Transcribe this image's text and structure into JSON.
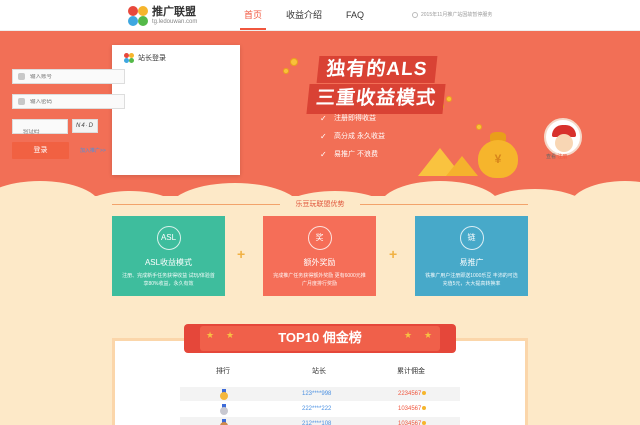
{
  "header": {
    "logo_title": "推广联盟",
    "logo_sub": "tg.ledouwan.com",
    "nav": [
      {
        "label": "首页",
        "active": true
      },
      {
        "label": "收益介绍",
        "active": false
      },
      {
        "label": "FAQ",
        "active": false
      }
    ],
    "notice": "2015年11月推广站因故暂停服务"
  },
  "login": {
    "title": "站长登录",
    "username_placeholder": "输入账号",
    "password_placeholder": "输入密码",
    "captcha_placeholder": "验证码",
    "captcha_text": "N4·D",
    "submit_label": "登录",
    "promo_link": "加入推广>>"
  },
  "hero": {
    "slogan_line1": "独有的ALS",
    "slogan_line2": "三重收益模式",
    "features": [
      "注册即得收益",
      "高分成  永久收益",
      "易推广  不浪费"
    ],
    "avatar_caption_prefix": "查看 ",
    "avatar_caption_link": "注册"
  },
  "advantages": {
    "section_title": "乐豆玩联盟优势",
    "cards": [
      {
        "icon_text": "ASL",
        "title": "ASL收益模式",
        "desc": "注册、完成新手任务获得收益 试玩/体验首享80%收益，永久有效",
        "color": "#3ebd9d"
      },
      {
        "icon_text": "奖",
        "title": "额外奖励",
        "desc": "完成推广任务获得额外奖励 更有6000元推广月度排行奖励",
        "color": "#f56e58"
      },
      {
        "icon_text": "链",
        "title": "易推广",
        "desc": "铁推广用户注册即送1000乐豆 丰沛的可选充值5元，大大提高转换率",
        "color": "#47a9c9"
      }
    ]
  },
  "ranking": {
    "title": "TOP10 佣金榜",
    "headers": [
      "排行",
      "站长",
      "累计佣金"
    ],
    "rows": [
      {
        "site": "123****998",
        "amount": "2234567",
        "medal": "#f5b73b"
      },
      {
        "site": "222****222",
        "amount": "1034567",
        "medal": "#c8c8d0"
      },
      {
        "site": "212****108",
        "amount": "1034567",
        "medal": "#d08a4d"
      }
    ]
  },
  "colors": {
    "accent": "#f0563e",
    "hero_bg": "#f26f56",
    "cream": "#fde9c8"
  }
}
